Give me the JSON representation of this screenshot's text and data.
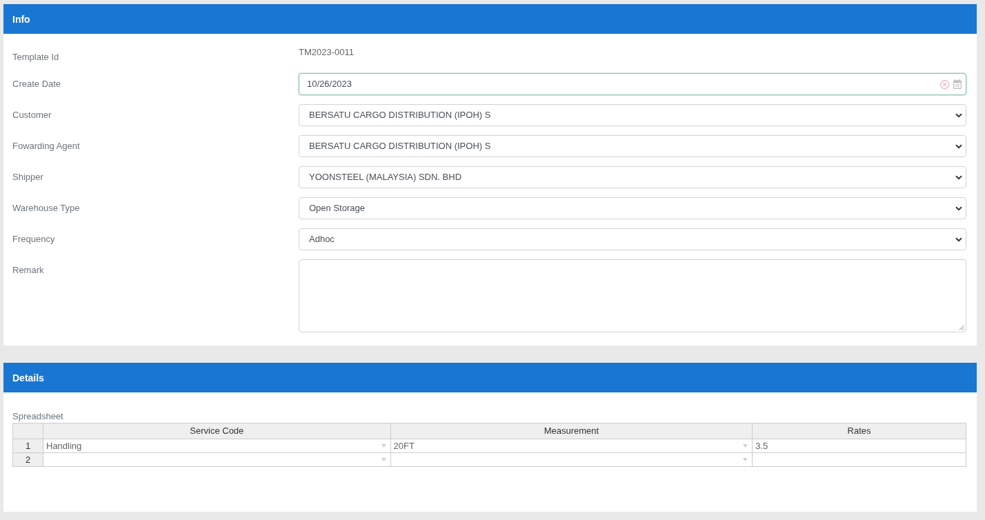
{
  "info": {
    "title": "Info",
    "fields": [
      {
        "label": "Template Id",
        "kind": "text",
        "value": "TM2023-0011",
        "focused": false
      },
      {
        "label": "Create Date",
        "kind": "date",
        "value": "10/26/2023",
        "focused": true
      },
      {
        "label": "Customer",
        "kind": "select",
        "value": "BERSATU CARGO DISTRIBUTION (IPOH) S",
        "focused": false
      },
      {
        "label": "Fowarding Agent",
        "kind": "select",
        "value": "BERSATU CARGO DISTRIBUTION (IPOH) S",
        "focused": false
      },
      {
        "label": "Shipper",
        "kind": "select",
        "value": "YOONSTEEL (MALAYSIA) SDN. BHD",
        "focused": false
      },
      {
        "label": "Warehouse Type",
        "kind": "select",
        "value": "Open Storage",
        "focused": false
      },
      {
        "label": "Frequency",
        "kind": "select",
        "value": "Adhoc",
        "focused": false
      },
      {
        "label": "Remark",
        "kind": "textarea",
        "focused": false
      }
    ]
  },
  "details": {
    "title": "Details",
    "spreadsheet": {
      "label": "Spreadsheet",
      "columns": [
        {
          "header": "Service Code",
          "kind": "dropdown"
        },
        {
          "header": "Measurement",
          "kind": "dropdown"
        },
        {
          "header": "Rates",
          "kind": "text"
        }
      ],
      "rows": [
        {
          "number": "1",
          "cells": [
            "Handling",
            "20FT",
            "3.5"
          ]
        },
        {
          "number": "2"
        }
      ]
    }
  }
}
